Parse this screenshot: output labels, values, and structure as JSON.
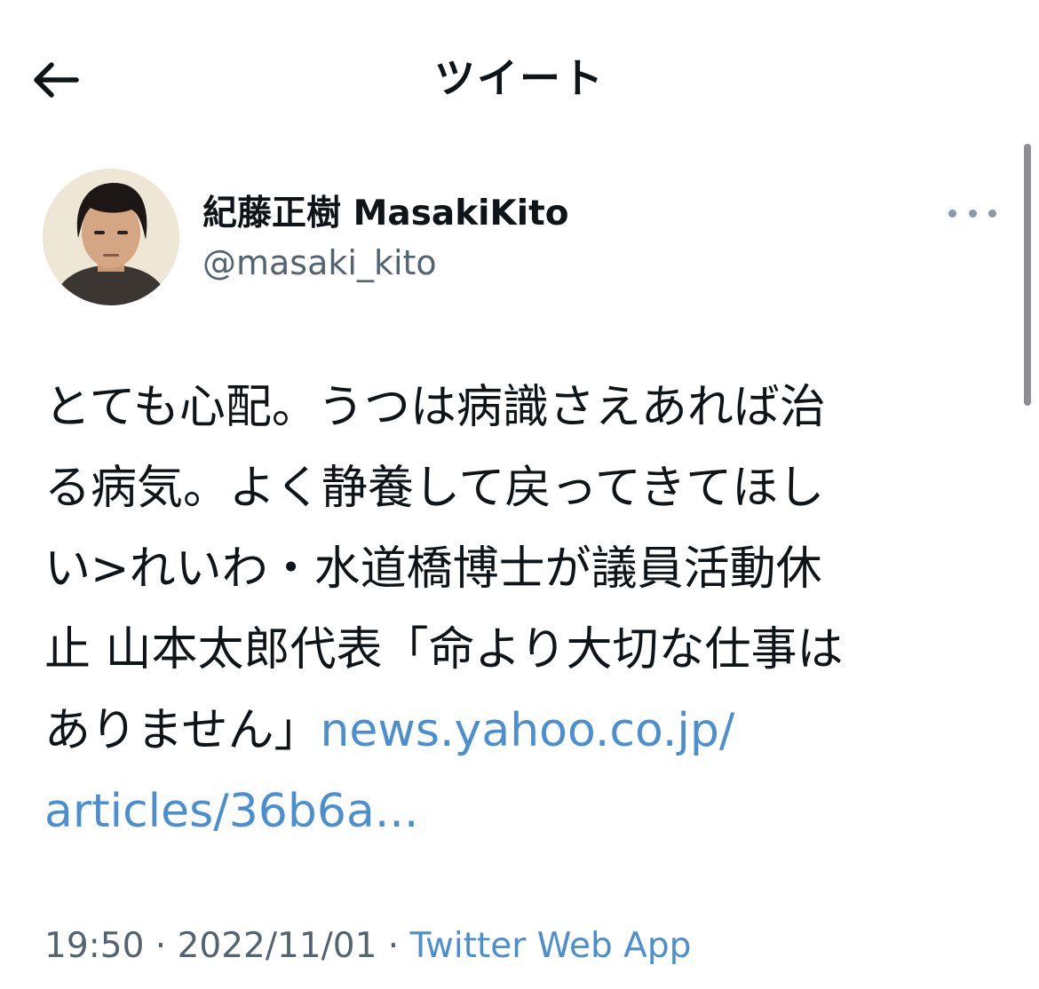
{
  "header": {
    "title": "ツイート",
    "back_icon": "arrow-left-icon"
  },
  "author": {
    "name": "紀藤正樹 MasakiKito",
    "handle": "@masaki_kito",
    "more_icon": "more-horizontal-icon"
  },
  "tweet": {
    "lines": [
      "とても心配。うつは病識さえあれば治",
      "る病気。よく静養して戻ってきてほし",
      "い>れいわ・水道橋博士が議員活動休",
      "止 山本太郎代表「命より大切な仕事は",
      "ありません」"
    ],
    "link_part1": "news.yahoo.co.jp/",
    "link_part2": "articles/36b6a..."
  },
  "meta": {
    "time": "19:50",
    "separator": " · ",
    "date": "2022/11/01",
    "source": "Twitter Web App"
  },
  "colors": {
    "link": "#4c8fd0",
    "secondary_text": "#536471",
    "primary_text": "#0f1419"
  }
}
